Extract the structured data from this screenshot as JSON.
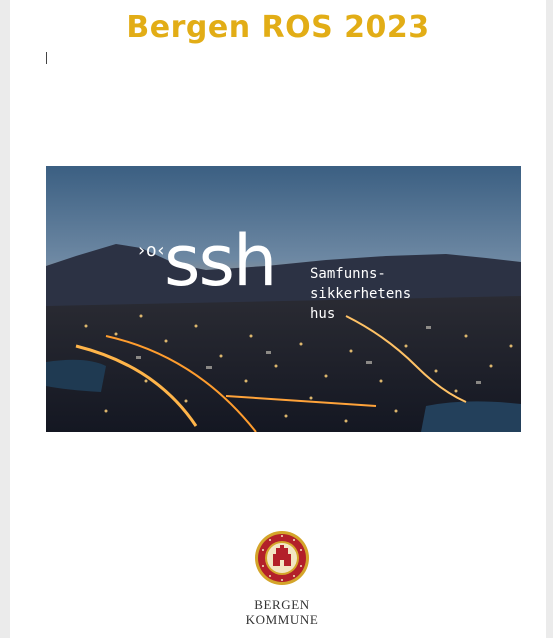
{
  "document": {
    "title": "Bergen ROS 2023",
    "title_color": "#e2ad16"
  },
  "hero": {
    "logo_word": "ssh",
    "logo_mark": "›o‹",
    "tagline_lines": [
      "Samfunns-",
      "sikkerhetens",
      "hus"
    ]
  },
  "footer": {
    "org_line1": "BERGEN",
    "org_line2": "KOMMUNE",
    "seal_icon": "bergen-coat-of-arms-seal"
  },
  "colors": {
    "page_bg": "#ffffff",
    "canvas_bg": "#ebebeb",
    "seal_red": "#b3202a",
    "seal_gold": "#d4a52a"
  }
}
